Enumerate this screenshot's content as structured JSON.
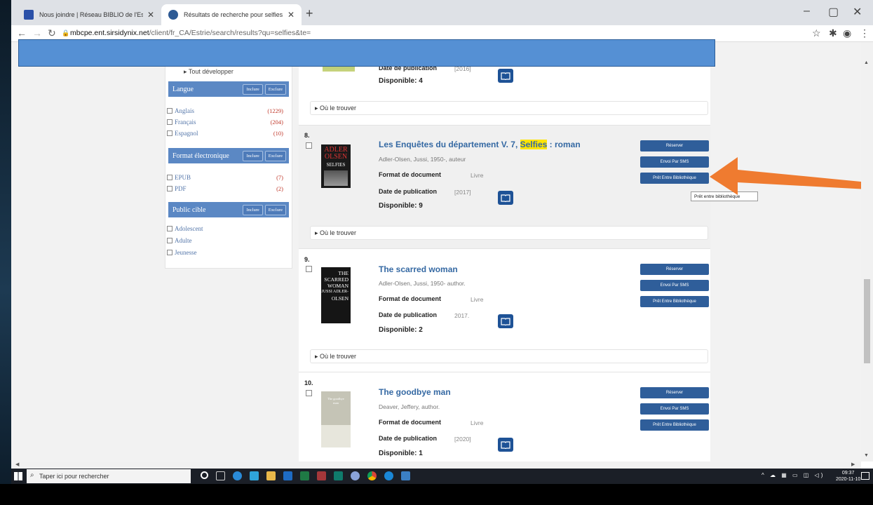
{
  "browser": {
    "tabs": [
      {
        "title": "Nous joindre | Réseau BIBLIO de l'Estrie",
        "close": "✕",
        "favicon_color": "#2a50a8"
      },
      {
        "title": "Résultats de recherche pour selfies",
        "close": "✕",
        "favicon_color": "#2e5a94"
      }
    ],
    "new_tab": "+",
    "url_domain": "mbcpe.ent.sirsidynix.net",
    "url_path": "/client/fr_CA/Estrie/search/results?qu=selfies&te=",
    "window_controls": [
      "–",
      "▢",
      "✕"
    ]
  },
  "sidebar": {
    "expand_all": "Tout développer",
    "include_label": "Inclure",
    "exclude_label": "Exclure",
    "facets": [
      {
        "title": "Langue",
        "items": [
          {
            "label": "Anglais",
            "count": "(1229)"
          },
          {
            "label": "Français",
            "count": "(204)"
          },
          {
            "label": "Espagnol",
            "count": "(10)"
          }
        ]
      },
      {
        "title": "Format électronique",
        "items": [
          {
            "label": "EPUB",
            "count": "(7)"
          },
          {
            "label": "PDF",
            "count": "(2)"
          }
        ]
      },
      {
        "title": "Public cible",
        "items": [
          {
            "label": "Adolescent",
            "count": ""
          },
          {
            "label": "Adulte",
            "count": ""
          },
          {
            "label": "Jeunesse",
            "count": ""
          }
        ]
      }
    ]
  },
  "labels": {
    "pub_date": "Date de publication",
    "doc_format": "Format de document",
    "where": "Où le trouver",
    "reserve": "Réserver",
    "sms": "Envoi Par SMS",
    "ill": "Prêt Entre Bibliothèque"
  },
  "partial_result": {
    "pub_date_value": "[2016]",
    "available": "Disponible: 4"
  },
  "results": [
    {
      "num": "8.",
      "title_pre": "Les Enquêtes du département V. 7, ",
      "title_hl": "Selfies",
      "title_post": " : roman",
      "author": "Adler-Olsen, Jussi, 1950-, auteur",
      "format": "Livre",
      "pub_date_value": "[2017]",
      "available": "Disponible: 9",
      "cover_text": [
        "ADLER",
        "OLSEN",
        "SELFIES"
      ]
    },
    {
      "num": "9.",
      "title_pre": "The scarred woman",
      "title_hl": "",
      "title_post": "",
      "author": "Adler-Olsen, Jussi, 1950- author.",
      "format": "Livre",
      "pub_date_value": "2017.",
      "available": "Disponible: 2",
      "cover_text": [
        "THE",
        "SCARRED",
        "WOMAN",
        "JUSSI ADLER-",
        "OLSEN"
      ]
    },
    {
      "num": "10.",
      "title_pre": "The goodbye man",
      "title_hl": "",
      "title_post": "",
      "author": "Deaver, Jeffery, author.",
      "format": "Livre",
      "pub_date_value": "[2020]",
      "available": "Disponible: 1",
      "cover_text": [
        "The goodbye",
        "man"
      ]
    }
  ],
  "tooltip": "Prêt entre bibliothèque",
  "taskbar": {
    "search_placeholder": "Taper ici pour rechercher",
    "time": "09:37",
    "date": "2020-11-10"
  }
}
